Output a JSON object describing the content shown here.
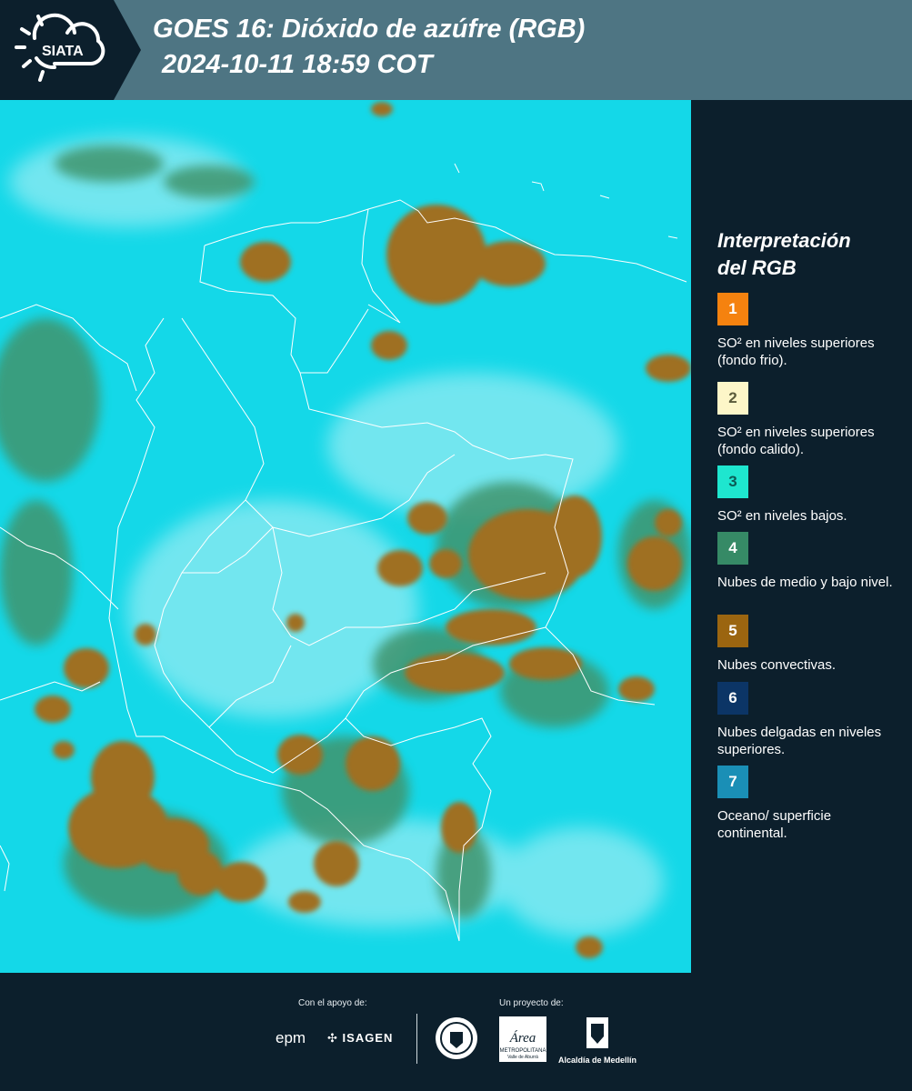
{
  "header": {
    "logo_text": "SIATA",
    "title_line1": "GOES 16: Dióxido de azúfre (RGB)",
    "title_line2": "2024-10-11 18:59 COT"
  },
  "legend": {
    "title_line1": "Interpretación",
    "title_line2": "del RGB",
    "items": [
      {
        "number": "1",
        "color": "#f5820f",
        "text": "SO² en niveles superiores (fondo frio)."
      },
      {
        "number": "2",
        "color": "#fdf6c8",
        "text": "SO² en niveles superiores (fondo calido)."
      },
      {
        "number": "3",
        "color": "#1ee6cf",
        "text": "SO² en niveles bajos."
      },
      {
        "number": "4",
        "color": "#368a66",
        "text": "Nubes de medio y bajo nivel."
      },
      {
        "number": "5",
        "color": "#9b6510",
        "text": "Nubes convectivas."
      },
      {
        "number": "6",
        "color": "#0c3566",
        "text": "Nubes delgadas en niveles superiores."
      },
      {
        "number": "7",
        "color": "#1a8fb6",
        "text": "Oceano/ superficie continental."
      }
    ]
  },
  "footer": {
    "support_caption": "Con el apoyo de:",
    "project_caption": "Un proyecto de:",
    "sponsor1": "epm",
    "sponsor2": "ISAGEN",
    "partner1_line1": "Área",
    "partner1_line2": "METROPOLITANA",
    "partner1_line3": "Valle de Aburrá",
    "partner2": "Alcaldía de Medellín"
  },
  "colors": {
    "background": "#0c1f2c",
    "header": "#4e7583",
    "map_base": "#12d6e6",
    "cloud_convective": "#9b6d1e",
    "cloud_low": "#3b8e6a",
    "border": "#ffffff"
  }
}
